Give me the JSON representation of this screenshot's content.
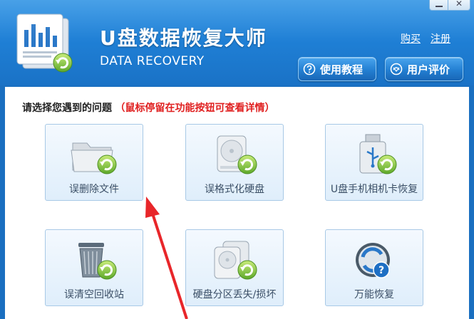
{
  "app": {
    "title": "U盘数据恢复大师",
    "subtitle": "DATA RECOVERY"
  },
  "window_controls": {
    "minimize_symbol": "",
    "close_symbol": "✕"
  },
  "header_links": {
    "buy": "购买",
    "register": "注册"
  },
  "header_buttons": [
    {
      "label": "使用教程",
      "icon": "question-circle-icon"
    },
    {
      "label": "用户评价",
      "icon": "feedback-icon"
    }
  ],
  "prompt": {
    "question": "请选择您遇到的问题",
    "hint": "（鼠标停留在功能按钮可查看详情）"
  },
  "cards": [
    {
      "label": "误删除文件",
      "icon": "folder-recover-icon"
    },
    {
      "label": "误格式化硬盘",
      "icon": "hard-drive-recover-icon"
    },
    {
      "label": "U盘手机相机卡恢复",
      "icon": "usb-drive-recover-icon"
    },
    {
      "label": "误清空回收站",
      "icon": "recycle-bin-recover-icon"
    },
    {
      "label": "硬盘分区丢失/损坏",
      "icon": "partition-recover-icon"
    },
    {
      "label": "万能恢复",
      "icon": "universal-recover-icon"
    }
  ],
  "colors": {
    "header_blue": "#1f80d6",
    "hint_red": "#e02020",
    "annotation_arrow": "#e8262a",
    "recover_badge_green": "#7ec43a"
  }
}
